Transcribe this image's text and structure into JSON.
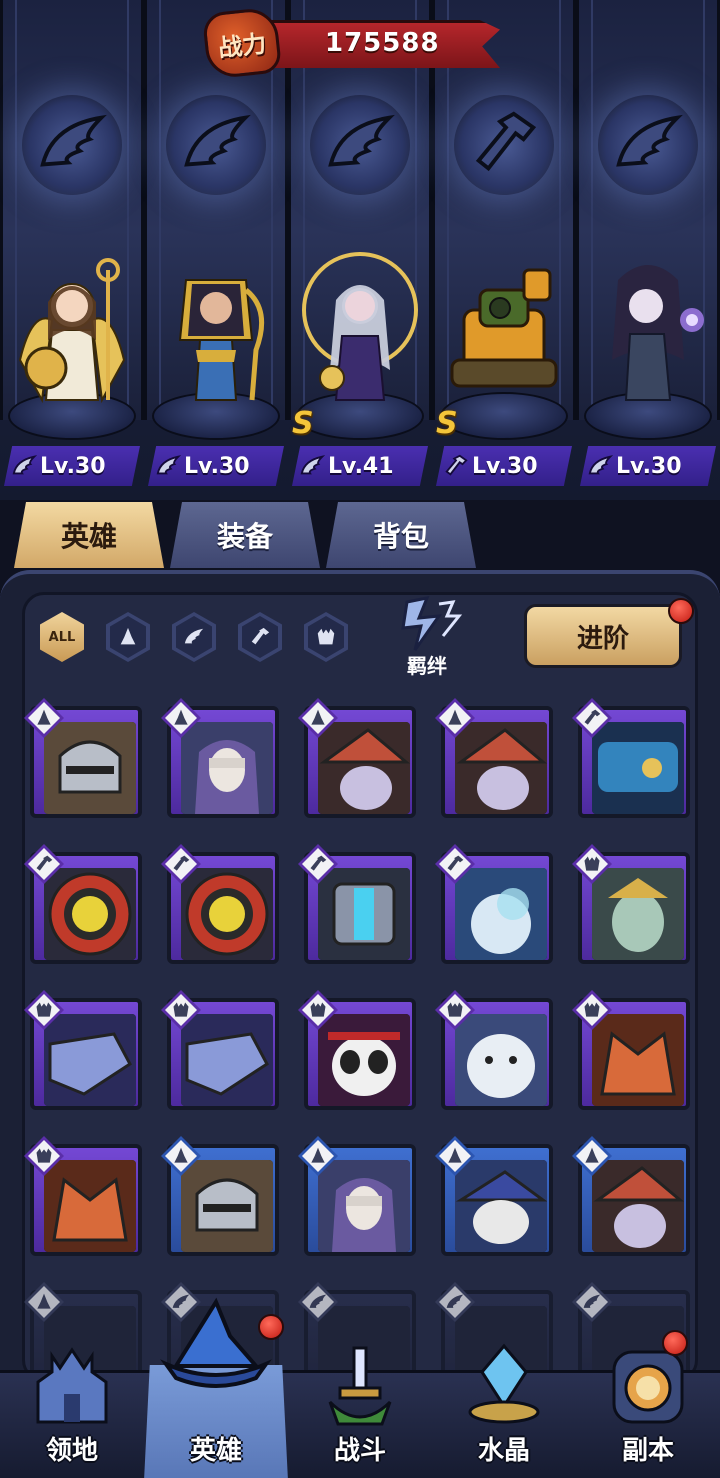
{
  "power": {
    "label": "战力",
    "value": "175588"
  },
  "lineup": [
    {
      "level": "Lv.30",
      "class_icon": "wing-icon",
      "star": ""
    },
    {
      "level": "Lv.30",
      "class_icon": "wing-icon",
      "star": ""
    },
    {
      "level": "Lv.41",
      "class_icon": "wing-icon",
      "star": "S"
    },
    {
      "level": "Lv.30",
      "class_icon": "wrench-icon",
      "star": "S"
    },
    {
      "level": "Lv.30",
      "class_icon": "wing-icon",
      "star": ""
    }
  ],
  "tabs": [
    "英雄",
    "装备",
    "背包"
  ],
  "filters": {
    "all": "ALL",
    "bond": "羁绊",
    "advance": "进阶"
  },
  "roster": [
    {
      "class": "tower",
      "rarity": "purple"
    },
    {
      "class": "tower",
      "rarity": "purple"
    },
    {
      "class": "tower",
      "rarity": "purple"
    },
    {
      "class": "tower",
      "rarity": "purple"
    },
    {
      "class": "wrench",
      "rarity": "purple"
    },
    {
      "class": "wrench",
      "rarity": "purple"
    },
    {
      "class": "wrench",
      "rarity": "purple"
    },
    {
      "class": "wrench",
      "rarity": "purple"
    },
    {
      "class": "wrench",
      "rarity": "purple"
    },
    {
      "class": "beast",
      "rarity": "purple"
    },
    {
      "class": "beast",
      "rarity": "purple"
    },
    {
      "class": "beast",
      "rarity": "purple"
    },
    {
      "class": "beast",
      "rarity": "purple"
    },
    {
      "class": "beast",
      "rarity": "purple"
    },
    {
      "class": "beast",
      "rarity": "purple"
    },
    {
      "class": "beast",
      "rarity": "purple"
    },
    {
      "class": "tower",
      "rarity": "blue"
    },
    {
      "class": "tower",
      "rarity": "blue"
    },
    {
      "class": "tower",
      "rarity": "blue"
    },
    {
      "class": "tower",
      "rarity": "blue"
    },
    {
      "class": "tower",
      "rarity": "dim"
    },
    {
      "class": "wing",
      "rarity": "dim"
    },
    {
      "class": "wing",
      "rarity": "dim"
    },
    {
      "class": "wing",
      "rarity": "dim"
    },
    {
      "class": "wing",
      "rarity": "dim"
    }
  ],
  "nav": [
    "领地",
    "英雄",
    "战斗",
    "水晶",
    "副本"
  ],
  "colors": {
    "accent_gold": "#d2a868",
    "rare_purple": "#6a3fc4",
    "rare_blue": "#3a66c4",
    "banner_red": "#b5262b"
  }
}
